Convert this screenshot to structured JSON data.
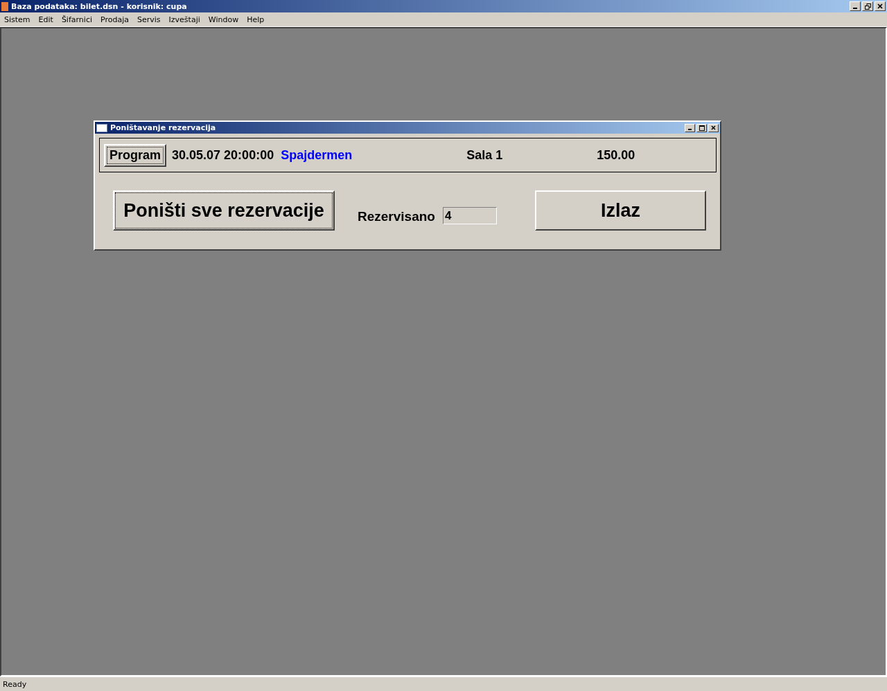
{
  "window": {
    "title": "Baza podataka: bilet.dsn  -  korisnik: cupa"
  },
  "menu": [
    "Sistem",
    "Edit",
    "Šifarnici",
    "Prodaja",
    "Servis",
    "Izveštaji",
    "Window",
    "Help"
  ],
  "dialog": {
    "title": "Poništavanje rezervacija",
    "program_button": "Program",
    "datetime": "30.05.07 20:00:00",
    "film": "Spajdermen",
    "hall": "Sala 1",
    "price": "150.00",
    "cancel_button": "Poništi sve rezervacije",
    "reserved_label": "Rezervisano",
    "reserved_value": "4",
    "exit_button": "Izlaz"
  },
  "status_bar": "Ready"
}
